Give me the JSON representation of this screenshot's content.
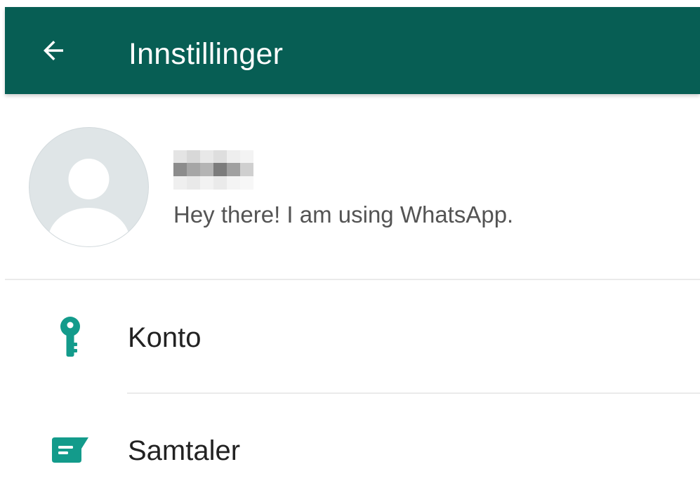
{
  "appbar": {
    "title": "Innstillinger",
    "back_icon": "arrow-back-icon",
    "background": "#075e54"
  },
  "profile": {
    "status": "Hey there! I am using WhatsApp.",
    "avatar_icon": "default-avatar-icon",
    "name_obscured": true
  },
  "menu": {
    "items": [
      {
        "label": "Konto",
        "icon": "key-icon"
      },
      {
        "label": "Samtaler",
        "icon": "chat-icon"
      }
    ]
  },
  "colors": {
    "header": "#075e54",
    "icon_accent": "#139b8b",
    "avatar_bg": "#dfe5e7",
    "text_primary": "#222222",
    "text_secondary": "#545454"
  }
}
